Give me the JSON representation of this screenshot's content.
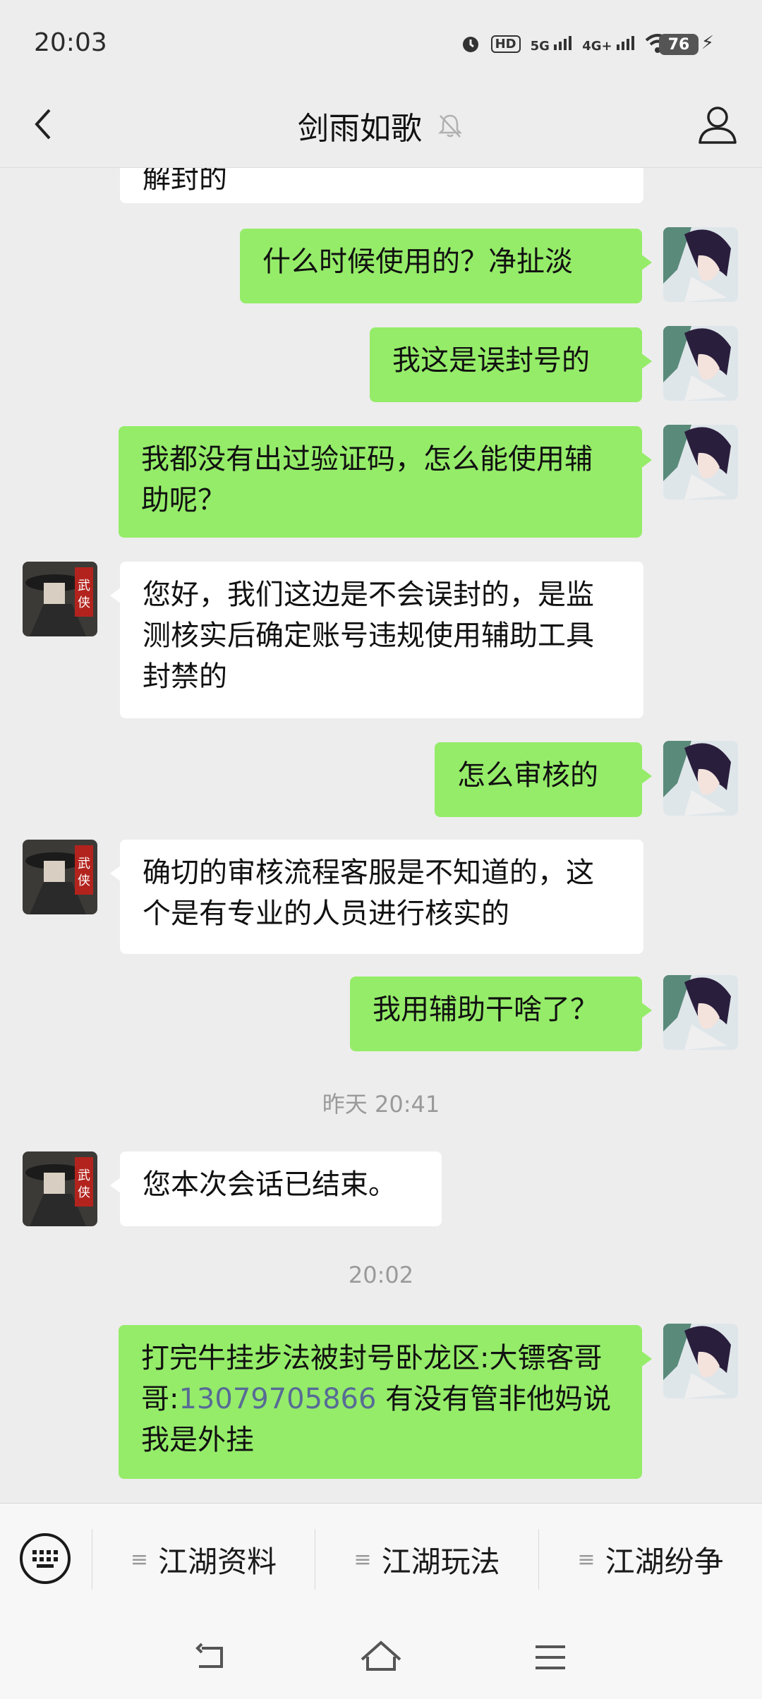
{
  "status_bar": {
    "time": "20:03",
    "hd_label": "HD",
    "net1_label": "5G",
    "net2_label": "4G+",
    "battery": "76",
    "icons": [
      "alarm-icon",
      "hd-icon",
      "signal-5g-icon",
      "signal-4g-icon",
      "wifi-icon",
      "battery-icon",
      "charging-icon"
    ]
  },
  "header": {
    "title": "剑雨如歌",
    "icons": [
      "back-arrow-icon",
      "mute-bell-icon",
      "profile-icon"
    ]
  },
  "messages": {
    "m0": {
      "sender": "them",
      "text": "解封的"
    },
    "m1": {
      "sender": "me",
      "text": "什么时候使用的？净扯淡"
    },
    "m2": {
      "sender": "me",
      "text": "我这是误封号的"
    },
    "m3": {
      "sender": "me",
      "text": "我都没有出过验证码，怎么能使用辅助呢？"
    },
    "m4": {
      "sender": "them",
      "text": "您好，我们这边是不会误封的，是监测核实后确定账号违规使用辅助工具封禁的"
    },
    "m5": {
      "sender": "me",
      "text": "怎么审核的"
    },
    "m6": {
      "sender": "them",
      "text": " 确切的审核流程客服是不知道的，这个是有专业的人员进行核实的"
    },
    "m7": {
      "sender": "me",
      "text": "我用辅助干啥了？"
    },
    "ts1": "昨天 20:41",
    "m8": {
      "sender": "them",
      "text": "您本次会话已结束。"
    },
    "ts2": "20:02",
    "m9": {
      "sender": "me",
      "text_before": "打完牛挂步法被封号卧龙区:大镖客哥哥:",
      "phone": "13079705866",
      "text_after": " 有没有管非他妈说我是外挂"
    }
  },
  "menu": {
    "items": [
      "江湖资料",
      "江湖玩法",
      "江湖纷争"
    ],
    "keyboard_icon": "keyboard-icon"
  },
  "nav": {
    "icons": [
      "back-nav-icon",
      "home-nav-icon",
      "menu-nav-icon"
    ]
  },
  "colors": {
    "my_bubble": "#95ec69",
    "their_bubble": "#ffffff",
    "background": "#ededed",
    "link": "#576b95"
  }
}
